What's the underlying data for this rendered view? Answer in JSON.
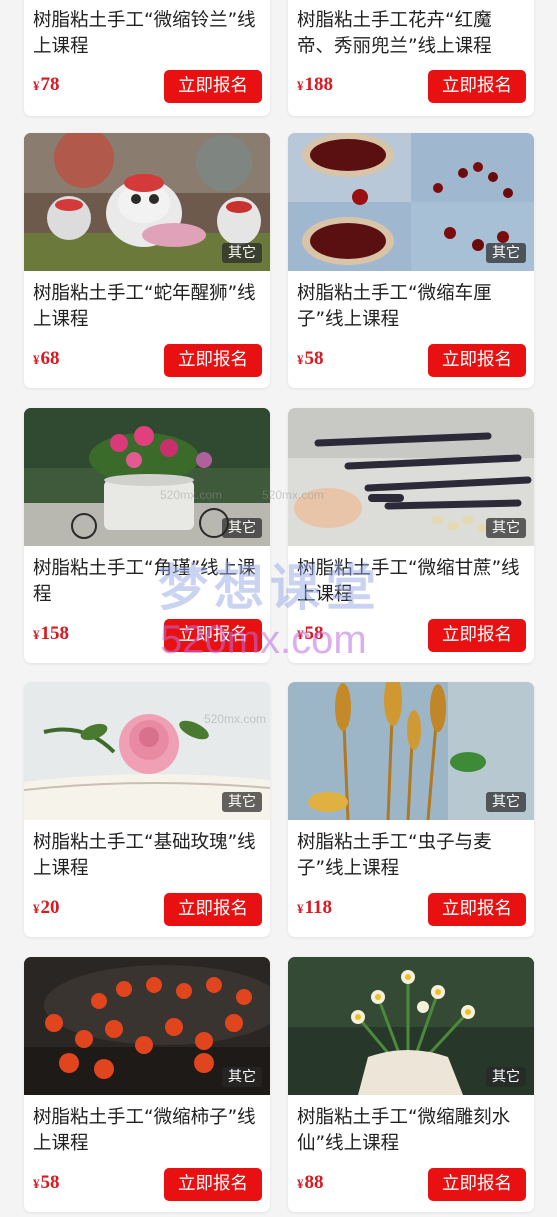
{
  "cards": [
    {
      "title": "树脂粘土手工“微缩铃兰”线上课程",
      "price": "78",
      "button": "立即报名",
      "tag": "",
      "image": "lily-of-the-valley"
    },
    {
      "title": "树脂粘土手工花卉“红魔帝、秀丽兜兰”线上课程",
      "price": "188",
      "button": "立即报名",
      "tag": "",
      "image": "orchid"
    },
    {
      "title": "树脂粘土手工“蛇年醒狮”线上课程",
      "price": "68",
      "button": "立即报名",
      "tag": "其它",
      "image": "lion-dance"
    },
    {
      "title": "树脂粘土手工“微缩车厘子”线上课程",
      "price": "58",
      "button": "立即报名",
      "tag": "其它",
      "image": "cherries"
    },
    {
      "title": "树脂粘土手工“角瑾”线上课程",
      "price": "158",
      "button": "立即报名",
      "tag": "其它",
      "image": "flower-pot"
    },
    {
      "title": "树脂粘土手工“微缩甘蔗”线上课程",
      "price": "58",
      "button": "立即报名",
      "tag": "其它",
      "image": "sugarcane"
    },
    {
      "title": "树脂粘土手工“基础玫瑰”线上课程",
      "price": "20",
      "button": "立即报名",
      "tag": "其它",
      "image": "rose"
    },
    {
      "title": "树脂粘土手工“虫子与麦子”线上课程",
      "price": "118",
      "button": "立即报名",
      "tag": "其它",
      "image": "wheat"
    },
    {
      "title": "树脂粘土手工“微缩柿子”线上课程",
      "price": "58",
      "button": "立即报名",
      "tag": "其它",
      "image": "persimmons"
    },
    {
      "title": "树脂粘土手工“微缩雕刻水仙”线上课程",
      "price": "88",
      "button": "立即报名",
      "tag": "其它",
      "image": "narcissus"
    }
  ],
  "currency": "¥",
  "watermark": {
    "cn": "梦想课堂",
    "en": "520mx.com",
    "small": "520mx.com"
  },
  "colors": {
    "accent": "#e81010",
    "price": "#d9181f"
  }
}
